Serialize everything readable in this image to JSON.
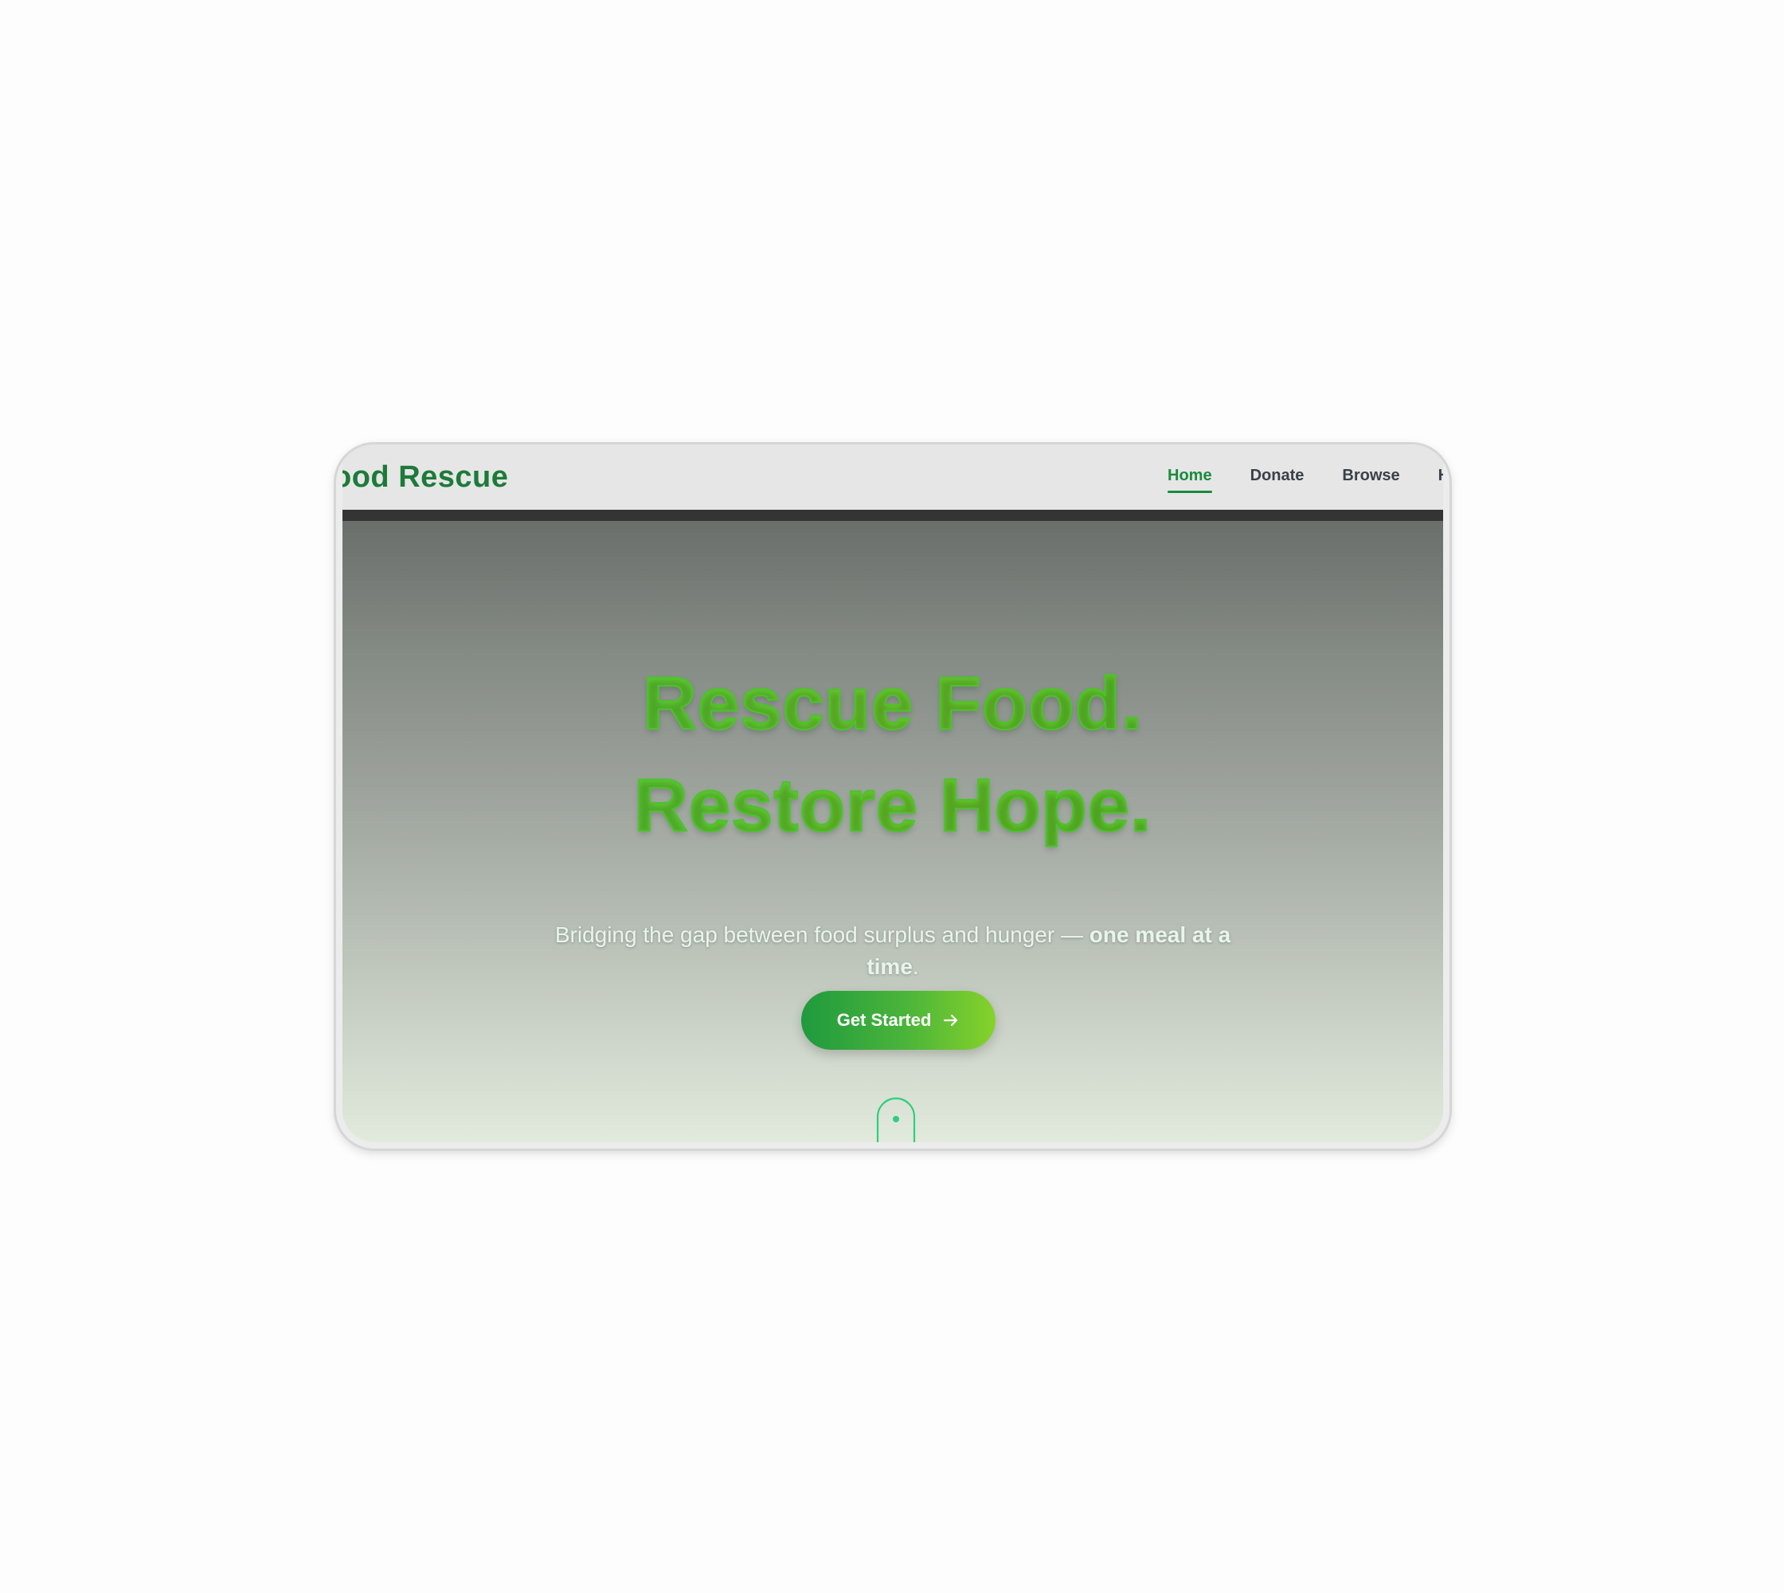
{
  "nav": {
    "brand": "ood Rescue",
    "links": [
      {
        "label": "Home",
        "active": true
      },
      {
        "label": "Donate",
        "active": false
      },
      {
        "label": "Browse",
        "active": false
      },
      {
        "label": "H",
        "active": false
      }
    ]
  },
  "hero": {
    "title_line1": "Rescue Food.",
    "title_line2": "Restore Hope.",
    "subtitle_prefix": "Bridging the gap between food surplus and hunger — ",
    "subtitle_emphasis": "one meal at a time",
    "subtitle_suffix": ".",
    "cta_label": "Get Started",
    "cta_icon": "arrow-right-icon",
    "scroll_icon": "mouse-scroll-icon"
  },
  "colors": {
    "brand_green": "#1d7a3a",
    "accent_green": "#4cbf2a",
    "nav_active": "#1a8a3e"
  }
}
